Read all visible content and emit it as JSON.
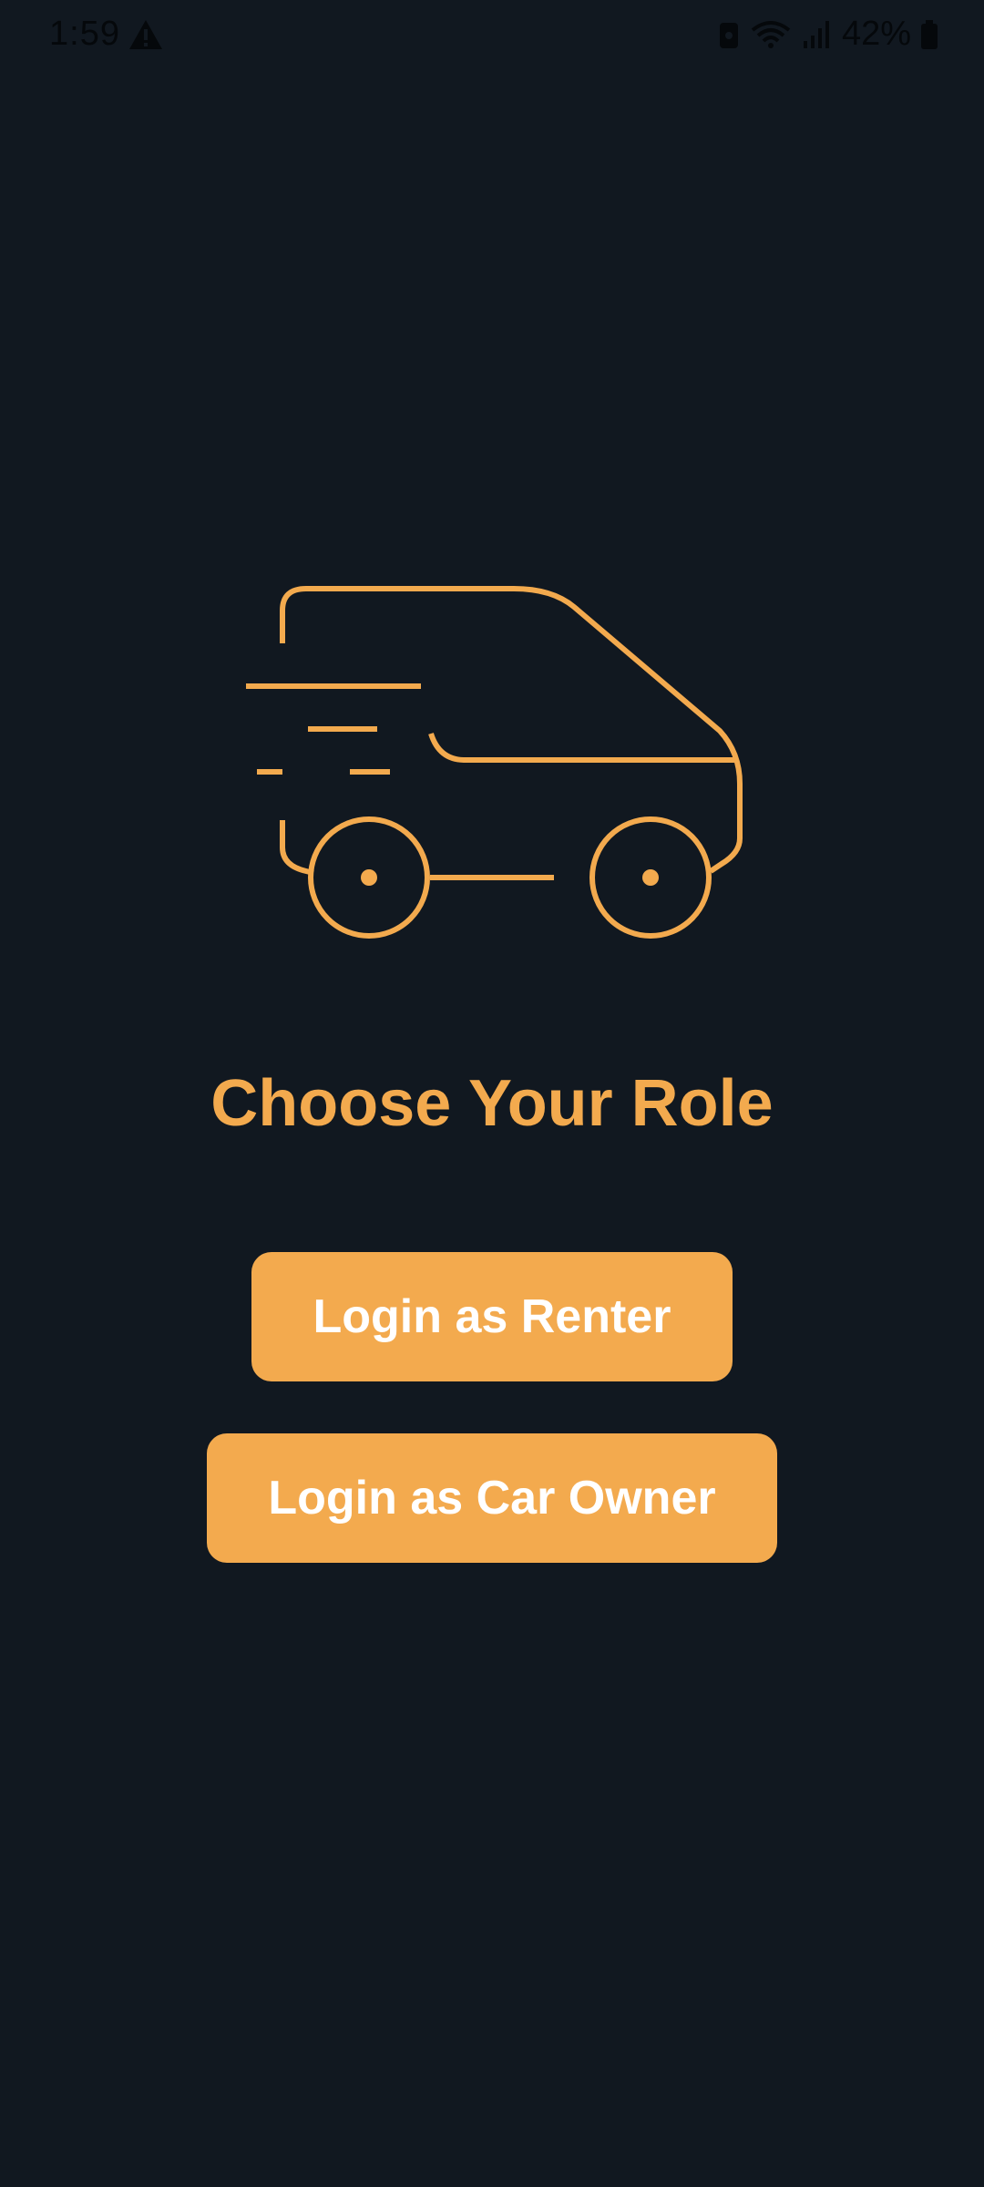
{
  "status_bar": {
    "time": "1:59",
    "battery_percent": "42%",
    "icons": [
      "warning-icon",
      "sim-icon",
      "wifi-icon",
      "signal-icon",
      "battery-icon"
    ]
  },
  "hero": {
    "icon": "van-moving-icon"
  },
  "title": "Choose Your Role",
  "buttons": {
    "renter_label": "Login as Renter",
    "owner_label": "Login as Car Owner"
  },
  "colors": {
    "background": "#111820",
    "accent": "#f3aa4e",
    "button_text": "#ffffff"
  }
}
